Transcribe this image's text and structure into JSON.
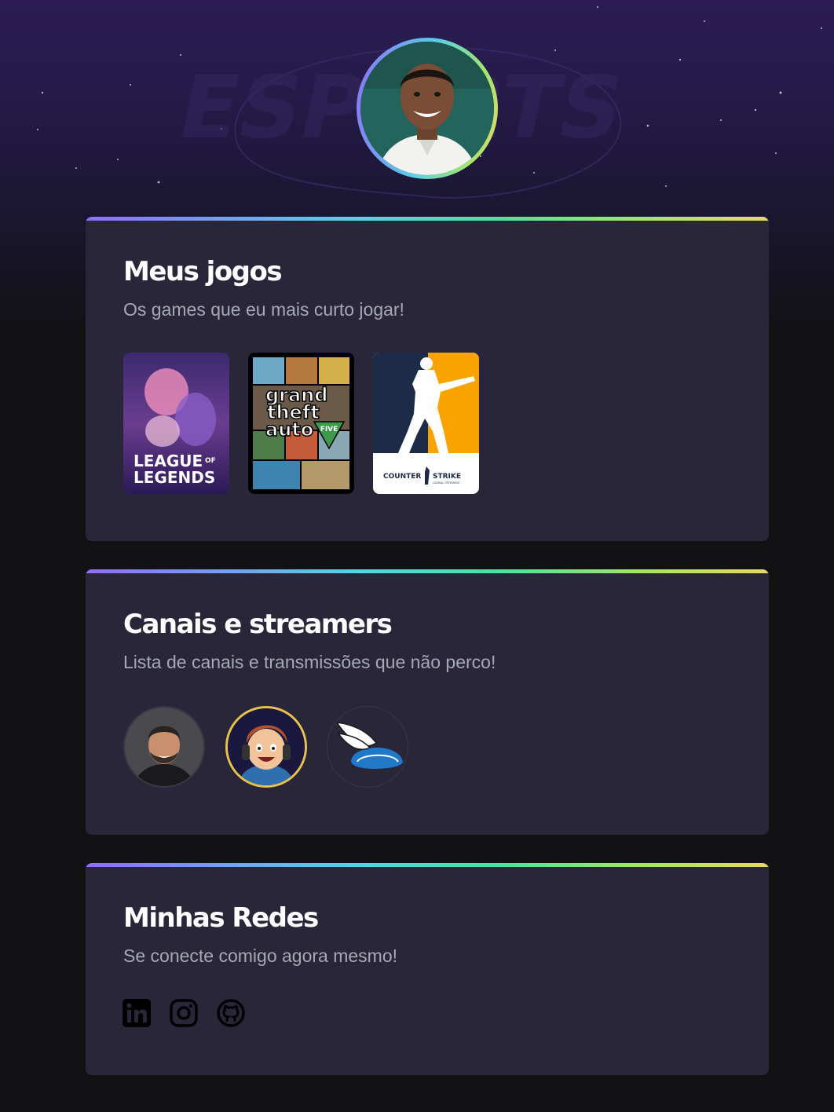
{
  "profile": {
    "avatar_alt": "Foto de perfil"
  },
  "games_section": {
    "title": "Meus jogos",
    "subtitle": "Os games que eu mais curto jogar!",
    "games": [
      {
        "name": "League of Legends",
        "logo_line1": "LEAGUE",
        "logo_of": "OF",
        "logo_line2": "LEGENDS"
      },
      {
        "name": "Grand Theft Auto V",
        "logo_line1": "grand",
        "logo_line2": "theft",
        "logo_line3": "auto",
        "logo_five": "FIVE",
        "logo_v": "V"
      },
      {
        "name": "Counter-Strike: Global Offensive",
        "logo_text_left": "COUNTER",
        "logo_text_right": "STRIKE",
        "logo_small": "GLOBAL OFFENSIVE"
      }
    ]
  },
  "streamers_section": {
    "title": "Canais e streamers",
    "subtitle": "Lista de canais e transmissões que não perco!",
    "streamers": [
      {
        "label": "streamer-1"
      },
      {
        "label": "streamer-2"
      },
      {
        "label": "streamer-3"
      }
    ]
  },
  "social_section": {
    "title": "Minhas Redes",
    "subtitle": "Se conecte comigo agora mesmo!",
    "icons": [
      "linkedin-icon",
      "instagram-icon",
      "github-icon"
    ]
  },
  "colors": {
    "background": "#121214",
    "card": "#29263a",
    "title": "#ffffff",
    "subtitle": "#a8a8b3",
    "gradient": [
      "#8f6ef7",
      "#5ad1e6",
      "#4fe0a0",
      "#9ee66b",
      "#e9d66b"
    ]
  }
}
